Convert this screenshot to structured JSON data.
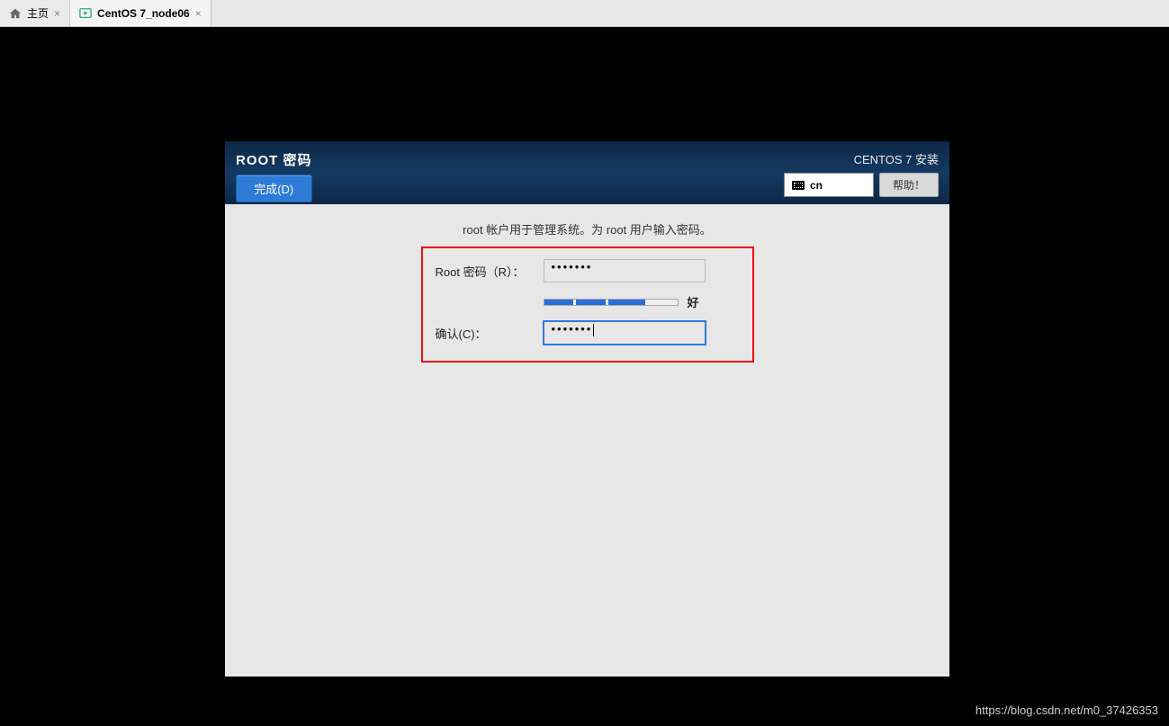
{
  "tabs": {
    "home": {
      "label": "主页"
    },
    "vm": {
      "label": "CentOS 7_node06"
    }
  },
  "installer": {
    "title": "ROOT 密码",
    "done_button": "完成(D)",
    "product": "CENTOS 7 安装",
    "keyboard_layout": "cn",
    "help_button": "帮助！",
    "description": "root 帐户用于管理系统。为 root 用户输入密码。",
    "password_label": "Root 密码（R）：",
    "password_value": "•••••••",
    "confirm_label": "确认(C)：",
    "confirm_value": "•••••••",
    "strength_label": "好"
  },
  "watermark": "https://blog.csdn.net/m0_37426353"
}
